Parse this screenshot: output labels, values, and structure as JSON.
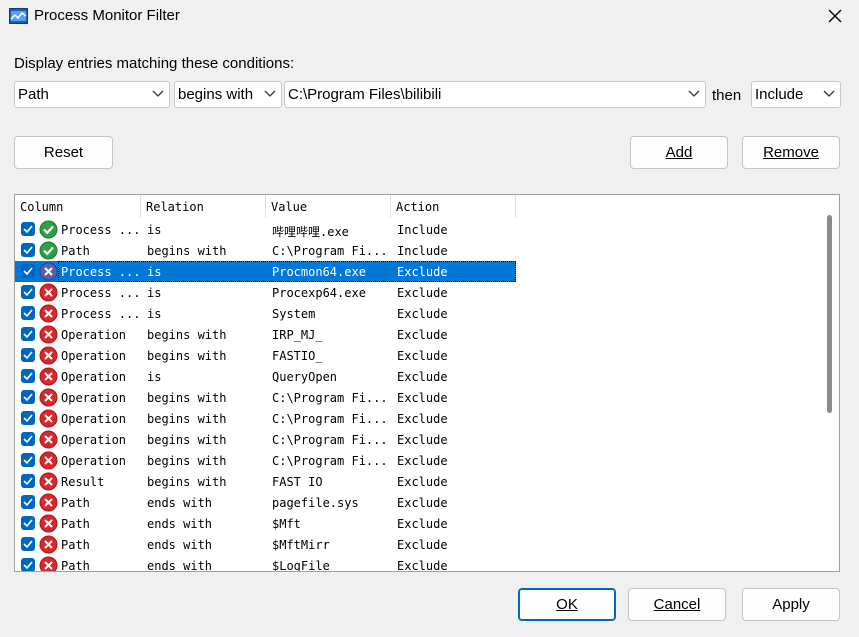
{
  "window": {
    "title": "Process Monitor Filter",
    "close_glyph": "✕",
    "app_icon": "process-monitor-icon"
  },
  "conditions": {
    "label": "Display entries matching these conditions:",
    "column": "Path",
    "relation": "begins with",
    "value": "C:\\Program Files\\bilibili",
    "then_label": "then",
    "action": "Include"
  },
  "buttons": {
    "reset": "Reset",
    "add": "Add",
    "remove": "Remove",
    "ok": "OK",
    "cancel": "Cancel",
    "apply": "Apply"
  },
  "list": {
    "headers": [
      "Column",
      "Relation",
      "Value",
      "Action"
    ],
    "rows": [
      {
        "column": "Process ...",
        "relation": "is",
        "value": "哔哩哔哩.exe",
        "action": "Include",
        "status": "include",
        "selected": false
      },
      {
        "column": "Path",
        "relation": "begins with",
        "value": "C:\\Program Fi...",
        "action": "Include",
        "status": "include",
        "selected": false
      },
      {
        "column": "Process ...",
        "relation": "is",
        "value": "Procmon64.exe",
        "action": "Exclude",
        "status": "exclude",
        "selected": true
      },
      {
        "column": "Process ...",
        "relation": "is",
        "value": "Procexp64.exe",
        "action": "Exclude",
        "status": "exclude",
        "selected": false
      },
      {
        "column": "Process ...",
        "relation": "is",
        "value": "System",
        "action": "Exclude",
        "status": "exclude",
        "selected": false
      },
      {
        "column": "Operation",
        "relation": "begins with",
        "value": "IRP_MJ_",
        "action": "Exclude",
        "status": "exclude",
        "selected": false
      },
      {
        "column": "Operation",
        "relation": "begins with",
        "value": "FASTIO_",
        "action": "Exclude",
        "status": "exclude",
        "selected": false
      },
      {
        "column": "Operation",
        "relation": "is",
        "value": "QueryOpen",
        "action": "Exclude",
        "status": "exclude",
        "selected": false
      },
      {
        "column": "Operation",
        "relation": "begins with",
        "value": "C:\\Program Fi...",
        "action": "Exclude",
        "status": "exclude",
        "selected": false
      },
      {
        "column": "Operation",
        "relation": "begins with",
        "value": "C:\\Program Fi...",
        "action": "Exclude",
        "status": "exclude",
        "selected": false
      },
      {
        "column": "Operation",
        "relation": "begins with",
        "value": "C:\\Program Fi...",
        "action": "Exclude",
        "status": "exclude",
        "selected": false
      },
      {
        "column": "Operation",
        "relation": "begins with",
        "value": "C:\\Program Fi...",
        "action": "Exclude",
        "status": "exclude",
        "selected": false
      },
      {
        "column": "Result",
        "relation": "begins with",
        "value": "FAST IO",
        "action": "Exclude",
        "status": "exclude",
        "selected": false
      },
      {
        "column": "Path",
        "relation": "ends with",
        "value": "pagefile.sys",
        "action": "Exclude",
        "status": "exclude",
        "selected": false
      },
      {
        "column": "Path",
        "relation": "ends with",
        "value": "$Mft",
        "action": "Exclude",
        "status": "exclude",
        "selected": false
      },
      {
        "column": "Path",
        "relation": "ends with",
        "value": "$MftMirr",
        "action": "Exclude",
        "status": "exclude",
        "selected": false
      },
      {
        "column": "Path",
        "relation": "ends with",
        "value": "$LogFile",
        "action": "Exclude",
        "status": "exclude",
        "selected": false
      }
    ]
  },
  "colors": {
    "selection": "#0078d7",
    "accent": "#0067c0",
    "include_green": "#2ea043",
    "exclude_red": "#d9262b"
  }
}
